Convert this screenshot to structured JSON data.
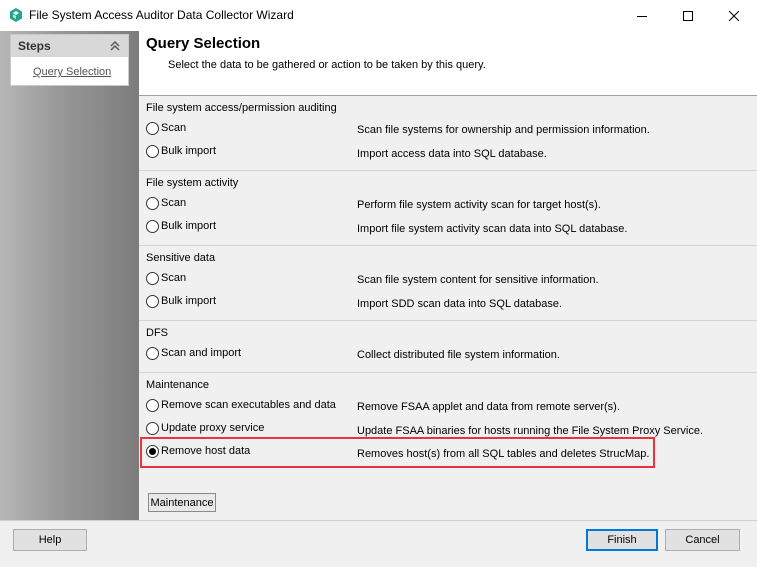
{
  "window": {
    "title": "File System Access Auditor Data Collector Wizard",
    "accent": "#2aa58c"
  },
  "sidebar": {
    "title": "Steps",
    "items": [
      {
        "label": "Query Selection"
      }
    ]
  },
  "header": {
    "title": "Query Selection",
    "description": "Select the data to be gathered or action to be taken by this query."
  },
  "groups": [
    {
      "title": "File system access/permission auditing",
      "options": [
        {
          "label": "Scan",
          "description": "Scan file systems for ownership and permission information.",
          "checked": false
        },
        {
          "label": "Bulk import",
          "description": "Import access data into SQL database.",
          "checked": false
        }
      ]
    },
    {
      "title": "File system activity",
      "options": [
        {
          "label": "Scan",
          "description": "Perform file system activity scan for target host(s).",
          "checked": false
        },
        {
          "label": "Bulk import",
          "description": "Import file system activity scan data into SQL database.",
          "checked": false
        }
      ]
    },
    {
      "title": "Sensitive data",
      "options": [
        {
          "label": "Scan",
          "description": "Scan file system content for sensitive information.",
          "checked": false
        },
        {
          "label": "Bulk import",
          "description": "Import SDD scan data into SQL database.",
          "checked": false
        }
      ]
    },
    {
      "title": "DFS",
      "options": [
        {
          "label": "Scan and import",
          "description": "Collect distributed file system information.",
          "checked": false
        }
      ]
    },
    {
      "title": "Maintenance",
      "options": [
        {
          "label": "Remove scan executables and data",
          "description": "Remove FSAA applet and data from remote server(s).",
          "checked": false
        },
        {
          "label": "Update proxy service",
          "description": "Update FSAA binaries for hosts running the File System Proxy Service.",
          "checked": false
        },
        {
          "label": "Remove host data",
          "description": "Removes host(s) from all SQL tables and deletes StrucMap.",
          "checked": true
        }
      ]
    }
  ],
  "maintenance_button": "Maintenance",
  "highlight_color": "#e8343c",
  "footer": {
    "help": "Help",
    "finish": "Finish",
    "cancel": "Cancel"
  }
}
